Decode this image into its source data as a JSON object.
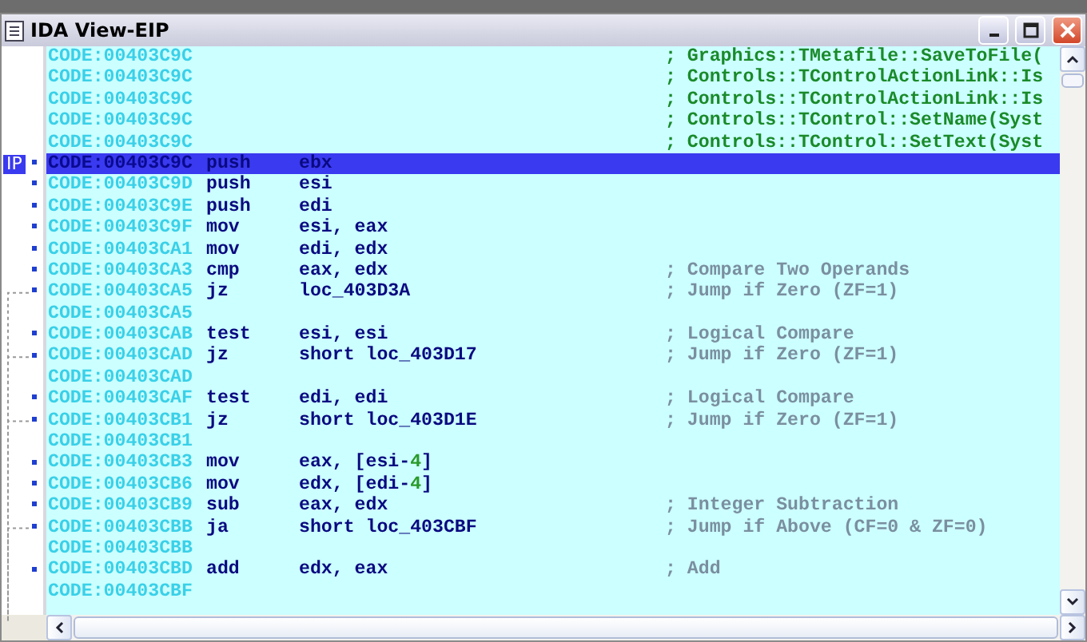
{
  "window": {
    "title": "IDA View-EIP"
  },
  "ip_label": "IP",
  "lines": [
    {
      "address": "CODE:00403C9C",
      "comment": "; Graphics::TMetafile::SaveToFile(",
      "color": "#1a8a2a",
      "marker": false,
      "current": false
    },
    {
      "address": "CODE:00403C9C",
      "comment": "; Controls::TControlActionLink::Is",
      "color": "#1a8a2a",
      "marker": false,
      "current": false
    },
    {
      "address": "CODE:00403C9C",
      "comment": "; Controls::TControlActionLink::Is",
      "color": "#1a8a2a",
      "marker": false,
      "current": false
    },
    {
      "address": "CODE:00403C9C",
      "comment": "; Controls::TControl::SetName(Syst",
      "color": "#1a8a2a",
      "marker": false,
      "current": false
    },
    {
      "address": "CODE:00403C9C",
      "comment": "; Controls::TControl::SetText(Syst",
      "color": "#1a8a2a",
      "marker": false,
      "current": false
    },
    {
      "address": "CODE:00403C9C",
      "mnemonic": "push",
      "operands": [
        {
          "text": "ebx"
        }
      ],
      "marker": true,
      "current": true
    },
    {
      "address": "CODE:00403C9D",
      "mnemonic": "push",
      "operands": [
        {
          "text": "esi"
        }
      ],
      "marker": true,
      "current": false
    },
    {
      "address": "CODE:00403C9E",
      "mnemonic": "push",
      "operands": [
        {
          "text": "edi"
        }
      ],
      "marker": true,
      "current": false
    },
    {
      "address": "CODE:00403C9F",
      "mnemonic": "mov",
      "operands": [
        {
          "text": "esi, eax"
        }
      ],
      "marker": true,
      "current": false
    },
    {
      "address": "CODE:00403CA1",
      "mnemonic": "mov",
      "operands": [
        {
          "text": "edi, edx"
        }
      ],
      "marker": true,
      "current": false
    },
    {
      "address": "CODE:00403CA3",
      "mnemonic": "cmp",
      "operands": [
        {
          "text": "eax, edx"
        }
      ],
      "comment": "; Compare Two Operands",
      "color": "#7a8fa0",
      "marker": true,
      "current": false
    },
    {
      "address": "CODE:00403CA5",
      "mnemonic": "jz",
      "operands": [
        {
          "text": "loc_403D3A"
        }
      ],
      "comment": "; Jump if Zero (ZF=1)",
      "color": "#7a8fa0",
      "marker": true,
      "jump": true,
      "current": false
    },
    {
      "address": "CODE:00403CA5",
      "marker": false,
      "current": false
    },
    {
      "address": "CODE:00403CAB",
      "mnemonic": "test",
      "operands": [
        {
          "text": "esi, esi"
        }
      ],
      "comment": "; Logical Compare",
      "color": "#7a8fa0",
      "marker": true,
      "current": false
    },
    {
      "address": "CODE:00403CAD",
      "mnemonic": "jz",
      "operands": [
        {
          "text": "short loc_403D17"
        }
      ],
      "comment": "; Jump if Zero (ZF=1)",
      "color": "#7a8fa0",
      "marker": true,
      "jump": true,
      "current": false
    },
    {
      "address": "CODE:00403CAD",
      "marker": false,
      "current": false
    },
    {
      "address": "CODE:00403CAF",
      "mnemonic": "test",
      "operands": [
        {
          "text": "edi, edi"
        }
      ],
      "comment": "; Logical Compare",
      "color": "#7a8fa0",
      "marker": true,
      "current": false
    },
    {
      "address": "CODE:00403CB1",
      "mnemonic": "jz",
      "operands": [
        {
          "text": "short loc_403D1E"
        }
      ],
      "comment": "; Jump if Zero (ZF=1)",
      "color": "#7a8fa0",
      "marker": true,
      "jump": true,
      "current": false
    },
    {
      "address": "CODE:00403CB1",
      "marker": false,
      "current": false
    },
    {
      "address": "CODE:00403CB3",
      "mnemonic": "mov",
      "operands": [
        {
          "text": "eax, [esi-"
        },
        {
          "text": "4",
          "kind": "number"
        },
        {
          "text": "]"
        }
      ],
      "marker": true,
      "current": false
    },
    {
      "address": "CODE:00403CB6",
      "mnemonic": "mov",
      "operands": [
        {
          "text": "edx, [edi-"
        },
        {
          "text": "4",
          "kind": "number"
        },
        {
          "text": "]"
        }
      ],
      "marker": true,
      "current": false
    },
    {
      "address": "CODE:00403CB9",
      "mnemonic": "sub",
      "operands": [
        {
          "text": "eax, edx"
        }
      ],
      "comment": "; Integer Subtraction",
      "color": "#7a8fa0",
      "marker": true,
      "current": false
    },
    {
      "address": "CODE:00403CBB",
      "mnemonic": "ja",
      "operands": [
        {
          "text": "short loc_403CBF"
        }
      ],
      "comment": "; Jump if Above (CF=0 & ZF=0)",
      "color": "#7a8fa0",
      "marker": true,
      "jump": true,
      "current": false
    },
    {
      "address": "CODE:00403CBB",
      "marker": false,
      "current": false
    },
    {
      "address": "CODE:00403CBD",
      "mnemonic": "add",
      "operands": [
        {
          "text": "edx, eax"
        }
      ],
      "comment": "; Add",
      "color": "#7a8fa0",
      "marker": true,
      "current": false
    },
    {
      "address": "CODE:00403CBF",
      "marker": false,
      "current": false
    }
  ]
}
